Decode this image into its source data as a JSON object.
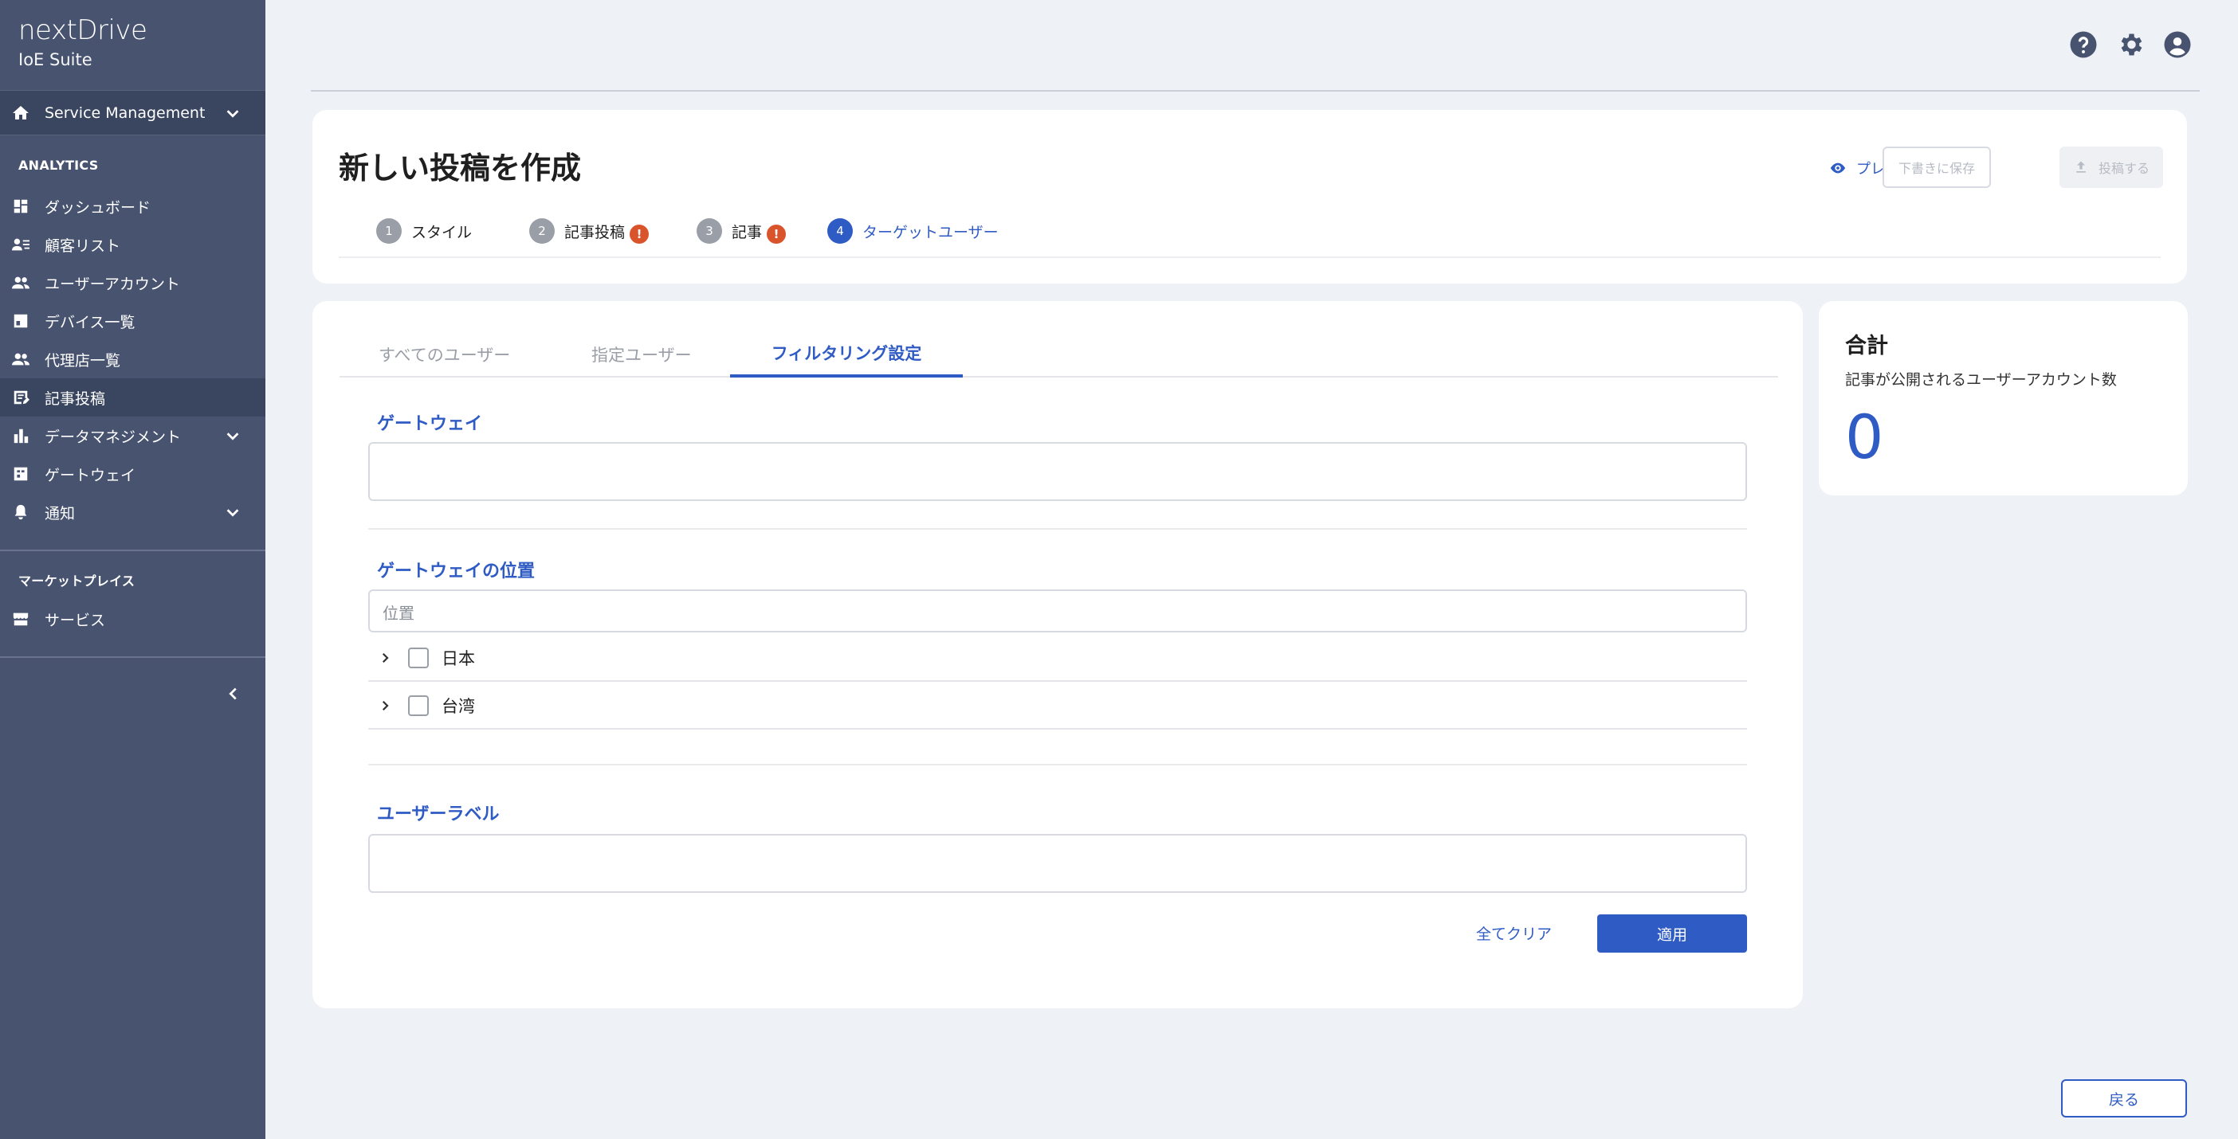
{
  "brand": {
    "name": "nextDrive",
    "sub": "IoE Suite"
  },
  "service_menu": {
    "label": "Service Management"
  },
  "sidebar": {
    "analytics_title": "ANALYTICS",
    "items": [
      {
        "label": "ダッシュボード"
      },
      {
        "label": "顧客リスト"
      },
      {
        "label": "ユーザーアカウント"
      },
      {
        "label": "デバイス一覧"
      },
      {
        "label": "代理店一覧"
      },
      {
        "label": "記事投稿"
      },
      {
        "label": "データマネジメント"
      },
      {
        "label": "ゲートウェイ"
      },
      {
        "label": "通知"
      }
    ],
    "market_title": "マーケットプレイス",
    "market_items": [
      {
        "label": "サービス"
      }
    ]
  },
  "header": {
    "title": "新しい投稿を作成",
    "preview": "プレビュー",
    "save_draft": "下書きに保存",
    "publish": "投稿する",
    "steps": [
      {
        "num": "1",
        "label": "スタイル"
      },
      {
        "num": "2",
        "label": "記事投稿"
      },
      {
        "num": "3",
        "label": "記事"
      },
      {
        "num": "4",
        "label": "ターゲットユーザー"
      }
    ],
    "warn_mark": "!"
  },
  "tabs": [
    {
      "label": "すべてのユーザー"
    },
    {
      "label": "指定ユーザー"
    },
    {
      "label": "フィルタリング設定"
    }
  ],
  "filters": {
    "gateway_label": "ゲートウェイ",
    "location_label": "ゲートウェイの位置",
    "location_placeholder": "位置",
    "locations": [
      {
        "label": "日本"
      },
      {
        "label": "台湾"
      }
    ],
    "user_label_label": "ユーザーラベル",
    "clear_all": "全てクリア",
    "apply": "適用"
  },
  "total": {
    "title": "合計",
    "subtitle": "記事が公開されるユーザーアカウント数",
    "count": "0"
  },
  "footer": {
    "back": "戻る"
  },
  "colors": {
    "sidebar": "#47536f",
    "accent": "#2f5bc4",
    "warning": "#d9542b"
  }
}
